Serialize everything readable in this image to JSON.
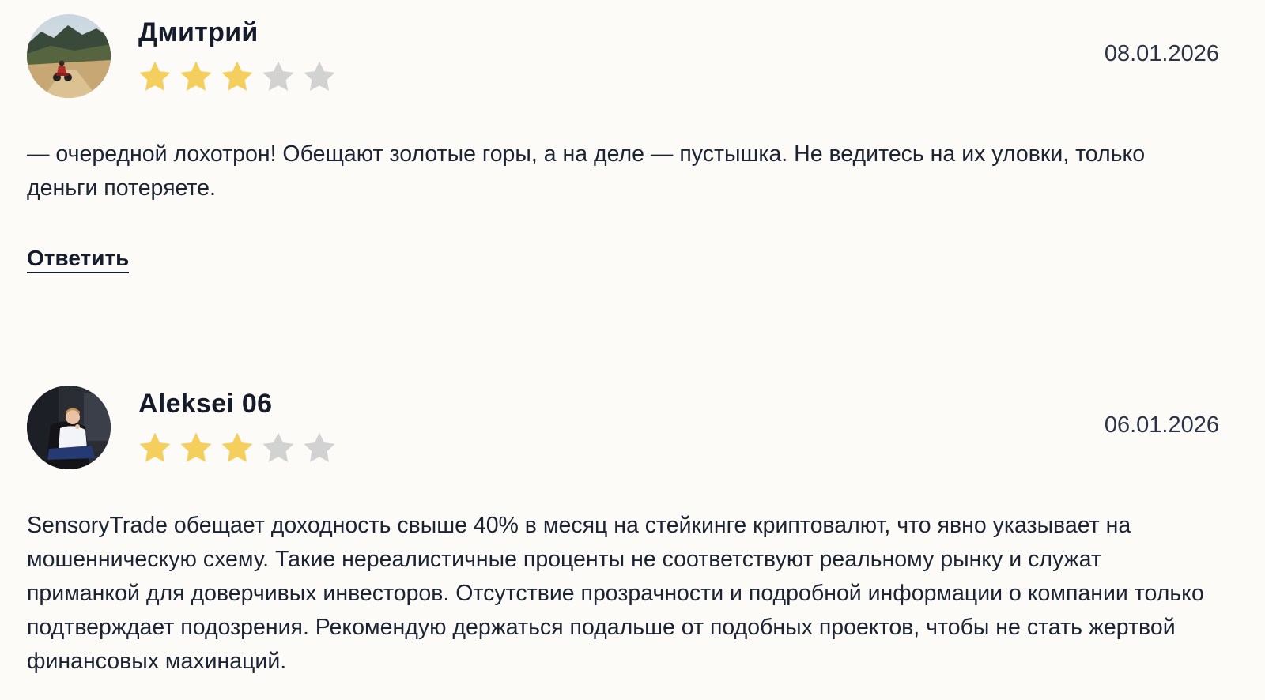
{
  "reviews": [
    {
      "author": "Дмитрий",
      "date": "08.01.2026",
      "rating": 3,
      "rating_max": 5,
      "text": "— очередной лохотрон! Обещают золотые горы, а на деле — пустышка. Не ведитесь на их уловки, только деньги потеряете.",
      "reply_label": "Ответить",
      "avatar_icon": "avatar-motorcyclist-photo"
    },
    {
      "author": "Aleksei 06",
      "date": "06.01.2026",
      "rating": 3,
      "rating_max": 5,
      "text": "SensoryTrade обещает доходность свыше 40% в месяц на стейкинге криптовалют, что явно указывает на мошенническую схему. Такие нереалистичные проценты не соответствуют реальному рынку и служат приманкой для доверчивых инвесторов. Отсутствие прозрачности и подробной информации о компании только подтверждает подозрения. Рекомендую держаться подальше от подобных проектов, чтобы не стать жертвой финансовых махинаций.",
      "avatar_icon": "avatar-man-in-chair-photo"
    }
  ],
  "colors": {
    "background": "#fdfbf8",
    "star_filled": "#f5cf5e",
    "star_empty": "#d2d2d2",
    "text": "#1c2433"
  }
}
